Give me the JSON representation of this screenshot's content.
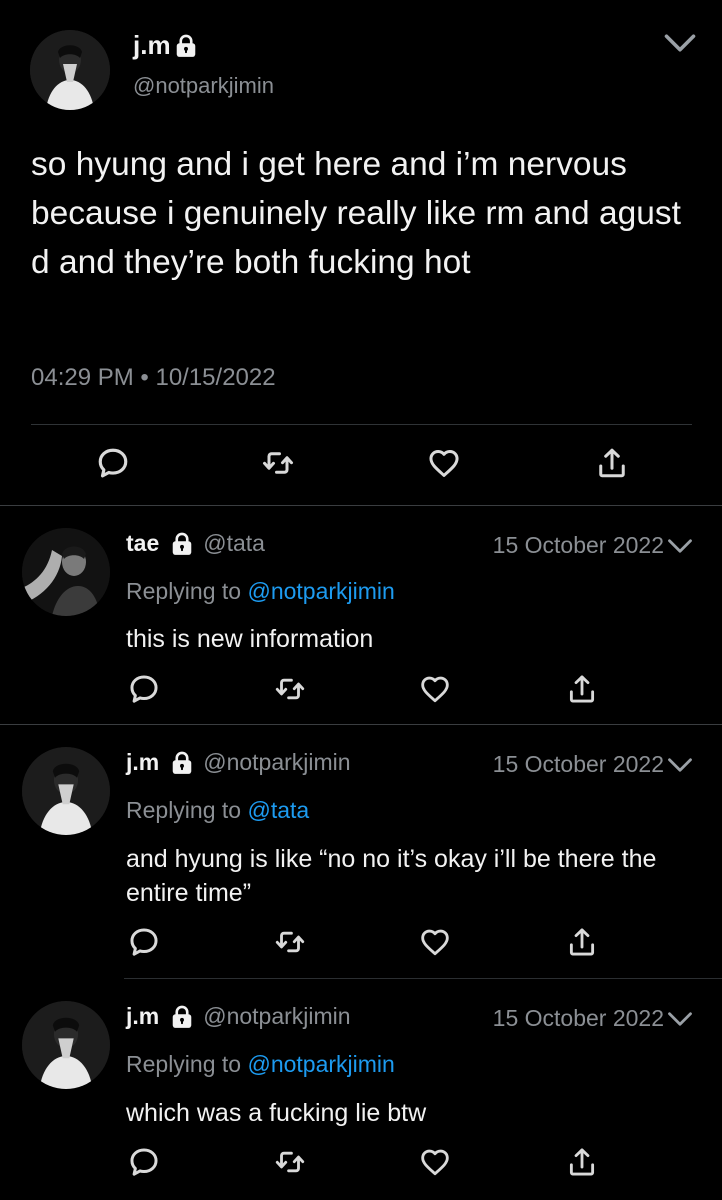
{
  "main_tweet": {
    "name": "j.m",
    "handle": "@notparkjimin",
    "text": "so hyung and i get here and i’m nervous because i genuinely really like rm and agust d and they’re both fucking hot",
    "timestamp": "04:29 PM • 10/15/2022"
  },
  "replies": [
    {
      "name": "tae",
      "handle": "@tata",
      "date": "15 October 2022",
      "replying_prefix": "Replying to ",
      "replying_to": "@notparkjimin",
      "text": "this is new information"
    },
    {
      "name": "j.m",
      "handle": "@notparkjimin",
      "date": "15 October 2022",
      "replying_prefix": "Replying to ",
      "replying_to": "@tata",
      "text": "and hyung is like “no no it’s okay i’ll be there the entire time”"
    },
    {
      "name": "j.m",
      "handle": "@notparkjimin",
      "date": "15 October 2022",
      "replying_prefix": "Replying to ",
      "replying_to": "@notparkjimin",
      "text": "which was a fucking lie btw"
    }
  ],
  "icons": {
    "reply": "speech-bubble-icon",
    "retweet": "retweet-icon",
    "like": "heart-icon",
    "share": "share-icon",
    "lock": "lock-icon",
    "more": "chevron-down-icon"
  },
  "colors": {
    "background": "#000000",
    "text": "#f2f2f2",
    "secondary": "#8b8f94",
    "link": "#1d9bf0",
    "divider": "#3a3d40"
  }
}
